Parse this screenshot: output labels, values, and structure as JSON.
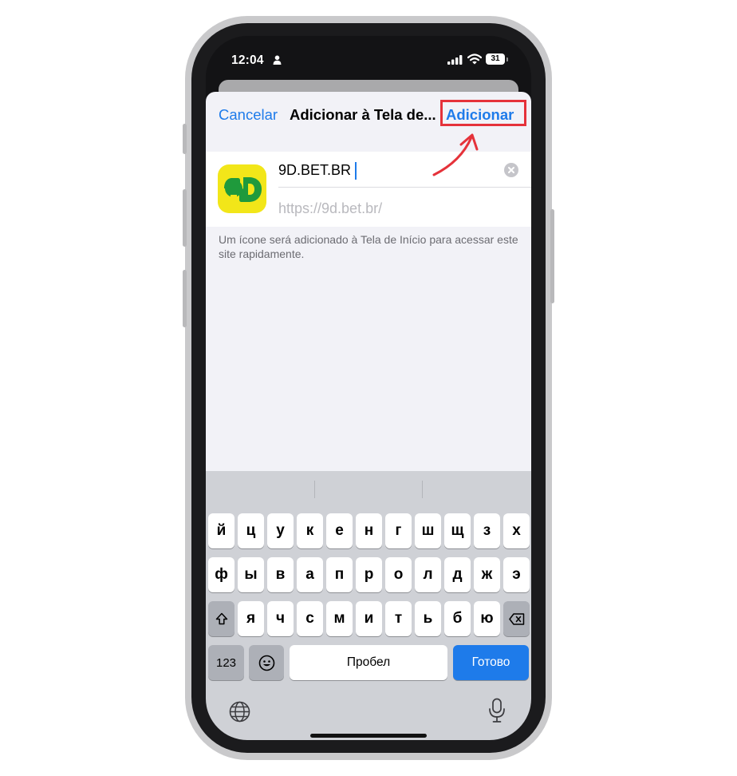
{
  "status_bar": {
    "time": "12:04",
    "battery": "31"
  },
  "sheet": {
    "cancel_label": "Cancelar",
    "title": "Adicionar à Tela de Início",
    "add_label": "Adicionar",
    "name_value": "9D.BET.BR",
    "url": "https://9d.bet.br/",
    "helper": "Um ícone será adicionado à Tela de Início para acessar este site rapidamente."
  },
  "keyboard": {
    "row1": [
      "й",
      "ц",
      "у",
      "к",
      "е",
      "н",
      "г",
      "ш",
      "щ",
      "з",
      "х"
    ],
    "row2": [
      "ф",
      "ы",
      "в",
      "а",
      "п",
      "р",
      "о",
      "л",
      "д",
      "ж",
      "э"
    ],
    "row3": [
      "я",
      "ч",
      "с",
      "м",
      "и",
      "т",
      "ь",
      "б",
      "ю"
    ],
    "numbers_label": "123",
    "space_label": "Пробел",
    "done_label": "Готово"
  },
  "colors": {
    "accent": "#1e7bea",
    "highlight": "#e5323a",
    "app_icon_bg": "#f2e619",
    "app_icon_fg": "#1f9a3c"
  },
  "icons": {
    "shift": "shift-icon",
    "delete": "delete-icon",
    "emoji": "emoji-icon",
    "globe": "globe-icon",
    "mic": "mic-icon",
    "clear": "clear-icon",
    "wifi": "wifi-icon",
    "signal": "signal-icon",
    "person": "person-icon"
  }
}
